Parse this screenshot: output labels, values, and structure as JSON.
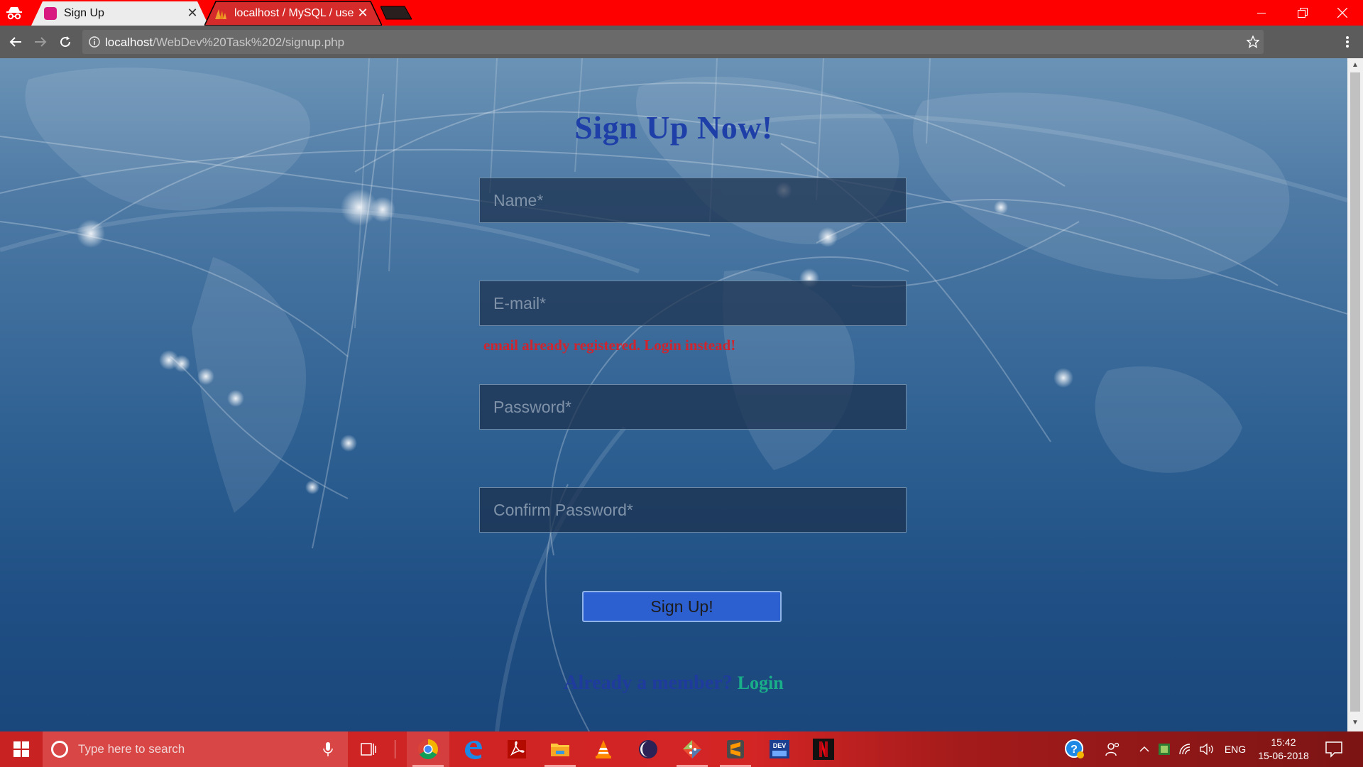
{
  "browser": {
    "tabs": [
      {
        "title": "Sign Up",
        "active": true,
        "favicon": "app-favicon-pink"
      },
      {
        "title": "localhost / MySQL / user",
        "active": false,
        "favicon": "phpmyadmin-favicon"
      }
    ],
    "url": {
      "host": "localhost",
      "path": "/WebDev%20Task%202/signup.php"
    },
    "theme_color": "#ff0000"
  },
  "page": {
    "heading": "Sign Up Now!",
    "fields": [
      {
        "id": "name",
        "placeholder": "Name*",
        "type": "text"
      },
      {
        "id": "email",
        "placeholder": "E-mail*",
        "type": "email"
      },
      {
        "id": "password",
        "placeholder": "Password*",
        "type": "password"
      },
      {
        "id": "confirm_password",
        "placeholder": "Confirm Password*",
        "type": "password"
      }
    ],
    "email_error": "email already registered. Login instead!",
    "submit_label": "Sign Up!",
    "member_prompt": "Already a member?",
    "login_link": "Login",
    "colors": {
      "heading": "#1f3fa8",
      "error": "#d0242e",
      "login_link": "#19b089",
      "button": "#2c5fd0"
    }
  },
  "taskbar": {
    "search_placeholder": "Type here to search",
    "apps": [
      "chrome",
      "edge",
      "acrobat-reader",
      "file-explorer",
      "vlc",
      "eclipse",
      "git",
      "sublime-text",
      "dev-cpp",
      "netflix"
    ],
    "tray_language": "ENG",
    "time": "15:42",
    "date": "15-06-2018"
  }
}
